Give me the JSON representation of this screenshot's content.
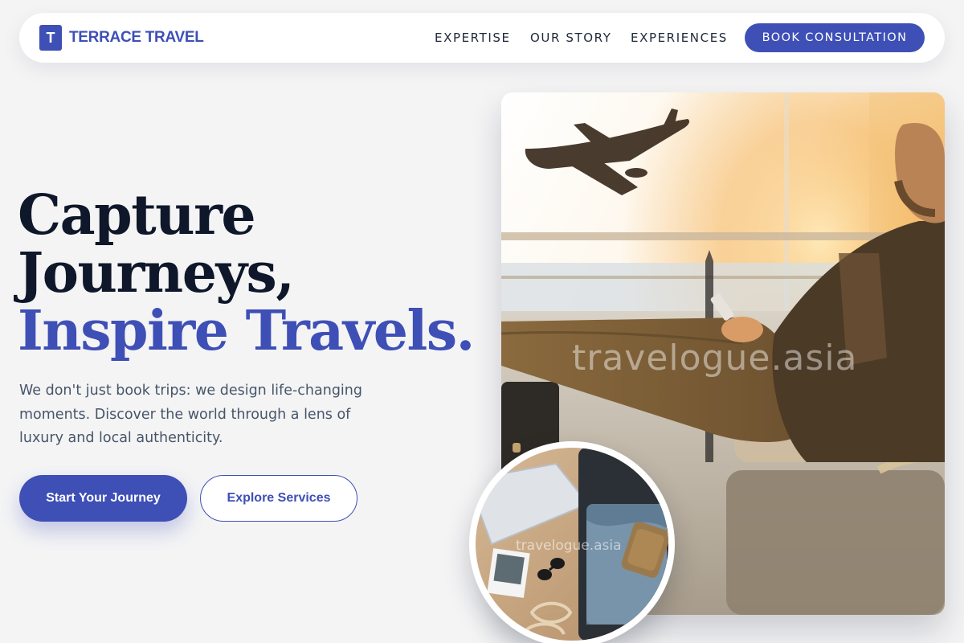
{
  "brand": {
    "mark": "T",
    "name": "TERRACE TRAVEL",
    "color": "#3e4fb6"
  },
  "nav": {
    "links": [
      "EXPERTISE",
      "OUR STORY",
      "EXPERIENCES"
    ],
    "cta": "BOOK CONSULTATION"
  },
  "hero": {
    "headline_line1": "Capture",
    "headline_line2": "Journeys,",
    "headline_line3": "Inspire Travels.",
    "lede": "We don't just book trips: we design life-changing moments. Discover the world through a lens of luxury and local authenticity.",
    "primary_button": "Start Your Journey",
    "secondary_button": "Explore Services"
  },
  "images": {
    "main_watermark": "travelogue.asia",
    "circle_watermark": "travelogue.asia",
    "main_icon": "airport-traveler-photo",
    "circle_icon": "packed-suitcase-photo"
  },
  "colors": {
    "accent": "#3e4fb6",
    "heading": "#0f172a",
    "body_text": "#475569",
    "background": "#f4f4f5"
  }
}
